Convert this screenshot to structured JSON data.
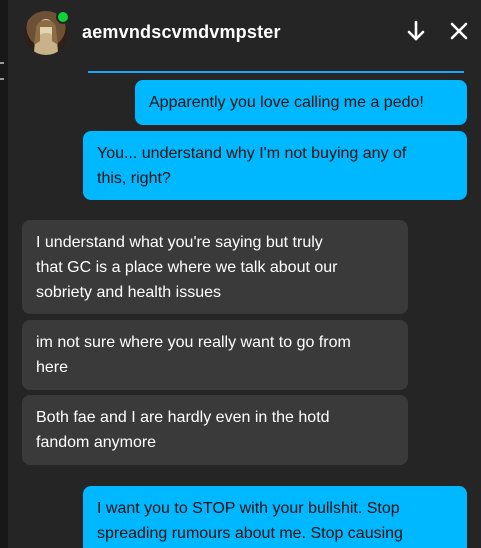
{
  "header": {
    "username": "aemvndscvmdvmpster",
    "status_color": "#10d13a"
  },
  "icons": {
    "down": "arrow-down-icon",
    "close": "close-icon"
  },
  "colors": {
    "outgoing_bubble": "#00b8ff",
    "incoming_bubble": "#3a3a3a",
    "background": "#252525"
  },
  "messages": [
    {
      "direction": "outgoing",
      "lines": [
        "Apparently you love calling me a pedo!"
      ]
    },
    {
      "direction": "outgoing",
      "lines": [
        "You... understand why I'm not buying any of",
        "this, right?"
      ]
    },
    {
      "direction": "incoming",
      "lines": [
        "I understand what you're saying but truly",
        "that GC is a place where we talk about our",
        "sobriety and health issues"
      ]
    },
    {
      "direction": "incoming",
      "lines": [
        "im not sure where you really want to go from",
        "here"
      ]
    },
    {
      "direction": "incoming",
      "lines": [
        "Both fae and I are hardly even in the hotd",
        "fandom anymore"
      ]
    },
    {
      "direction": "outgoing",
      "lines": [
        "I want you to STOP with your bullshit. Stop",
        "spreading rumours about me. Stop causing"
      ]
    }
  ]
}
